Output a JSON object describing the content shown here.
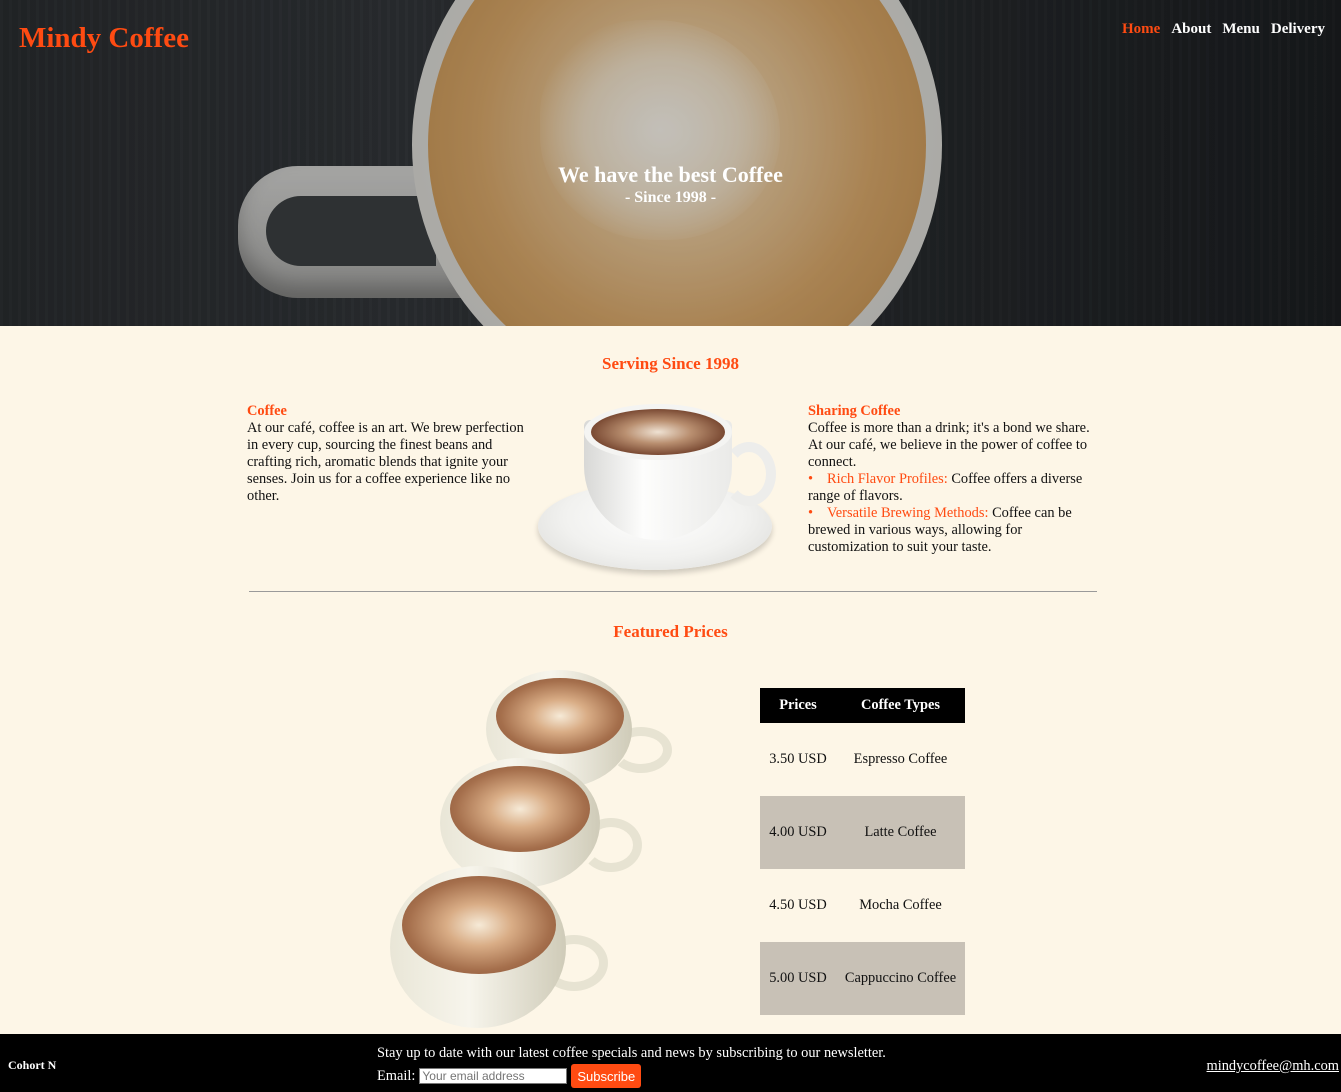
{
  "header": {
    "brand": "Mindy Coffee",
    "nav": [
      {
        "label": "Home",
        "active": true
      },
      {
        "label": "About",
        "active": false
      },
      {
        "label": "Menu",
        "active": false
      },
      {
        "label": "Delivery",
        "active": false
      }
    ]
  },
  "hero": {
    "title": "We have the best Coffee",
    "subtitle": "- Since 1998 -"
  },
  "serving": {
    "heading": "Serving Since 1998",
    "left": {
      "title": "Coffee",
      "text": "At our café, coffee is an art. We brew perfection in every cup, sourcing the finest beans and crafting rich, aromatic blends that ignite your senses. Join us for a coffee experience like no other."
    },
    "right": {
      "title": "Sharing Coffee",
      "text": "Coffee is more than a drink; it's a bond we share. At our café, we believe in the power of coffee to connect.",
      "bullets": [
        {
          "highlight": "Rich Flavor Profiles:",
          "text": " Coffee offers a diverse range of flavors."
        },
        {
          "highlight": "Versatile Brewing Methods:",
          "text": " Coffee can be brewed in various ways, allowing for customization to suit your taste."
        }
      ]
    }
  },
  "featured": {
    "heading": "Featured Prices",
    "table": {
      "headers": [
        "Prices",
        "Coffee Types"
      ],
      "rows": [
        [
          "3.50 USD",
          "Espresso Coffee"
        ],
        [
          "4.00 USD",
          "Latte Coffee"
        ],
        [
          "4.50 USD",
          "Mocha Coffee"
        ],
        [
          "5.00 USD",
          "Cappuccino Coffee"
        ]
      ]
    }
  },
  "footer": {
    "cohort": "Cohort N",
    "newsletter": "Stay up to date with our latest coffee specials and news by subscribing to our newsletter.",
    "email_label": "Email:",
    "email_placeholder": "Your email address",
    "subscribe_label": "Subscribe",
    "contact_email": "mindycoffee@mh.com"
  },
  "colors": {
    "accent": "#ff4b12",
    "background": "#fdf6e7",
    "row_alt": "#c8c1b6",
    "footer": "#000000"
  }
}
